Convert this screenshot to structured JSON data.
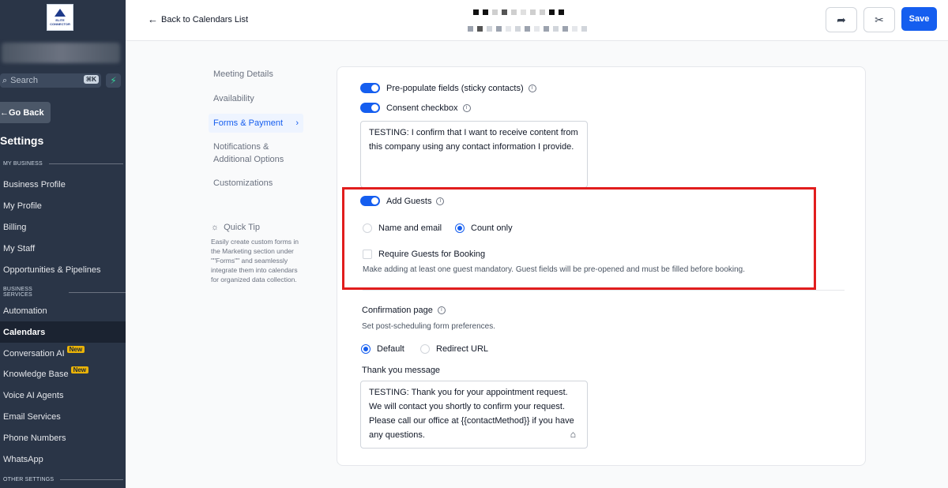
{
  "sidebar": {
    "logo_text": "ELITE CONNECTOR",
    "search_placeholder": "Search",
    "search_shortcut": "⌘K",
    "go_back": "Go Back",
    "settings_title": "Settings",
    "sections": [
      {
        "label": "MY BUSINESS"
      },
      {
        "label": "BUSINESS SERVICES"
      },
      {
        "label": "OTHER SETTINGS"
      }
    ],
    "items": [
      {
        "label": "Business Profile"
      },
      {
        "label": "My Profile"
      },
      {
        "label": "Billing"
      },
      {
        "label": "My Staff"
      },
      {
        "label": "Opportunities & Pipelines"
      },
      {
        "label": "Automation"
      },
      {
        "label": "Calendars"
      },
      {
        "label": "Conversation AI",
        "badge": "New"
      },
      {
        "label": "Knowledge Base",
        "badge": "New"
      },
      {
        "label": "Voice AI Agents"
      },
      {
        "label": "Email Services"
      },
      {
        "label": "Phone Numbers"
      },
      {
        "label": "WhatsApp"
      }
    ]
  },
  "topbar": {
    "back_label": "Back to Calendars List",
    "save_label": "Save"
  },
  "subnav": {
    "items": [
      {
        "label": "Meeting Details"
      },
      {
        "label": "Availability"
      },
      {
        "label": "Forms & Payment"
      },
      {
        "label": "Notifications & Additional Options"
      },
      {
        "label": "Customizations"
      }
    ],
    "quick_tip_title": "Quick Tip",
    "quick_tip_body": "Easily create custom forms in the Marketing section under \"\"Forms\"\" and seamlessly integrate them into calendars for organized data collection."
  },
  "form": {
    "prepopulate_label": "Pre-populate fields (sticky contacts)",
    "consent_label": "Consent checkbox",
    "consent_text": "TESTING: I confirm that I want to receive content from this company using any contact information I provide.",
    "add_guests_label": "Add Guests",
    "guest_options": [
      {
        "label": "Name and email",
        "selected": false
      },
      {
        "label": "Count only",
        "selected": true
      }
    ],
    "require_guests_label": "Require Guests for Booking",
    "require_guests_help": "Make adding at least one guest mandatory. Guest fields will be pre-opened and must be filled before booking.",
    "confirmation_title": "Confirmation page",
    "confirmation_help": "Set post-scheduling form preferences.",
    "confirmation_options": [
      {
        "label": "Default",
        "selected": true
      },
      {
        "label": "Redirect URL",
        "selected": false
      }
    ],
    "thank_you_label": "Thank you message",
    "thank_you_text": "TESTING: Thank you for your appointment request. We will contact you shortly to confirm your request. Please call our office at {{contactMethod}} if you have any questions."
  },
  "colors": {
    "accent": "#155eef",
    "sidebar_bg": "#2a3547",
    "highlight": "#e11d1d"
  }
}
